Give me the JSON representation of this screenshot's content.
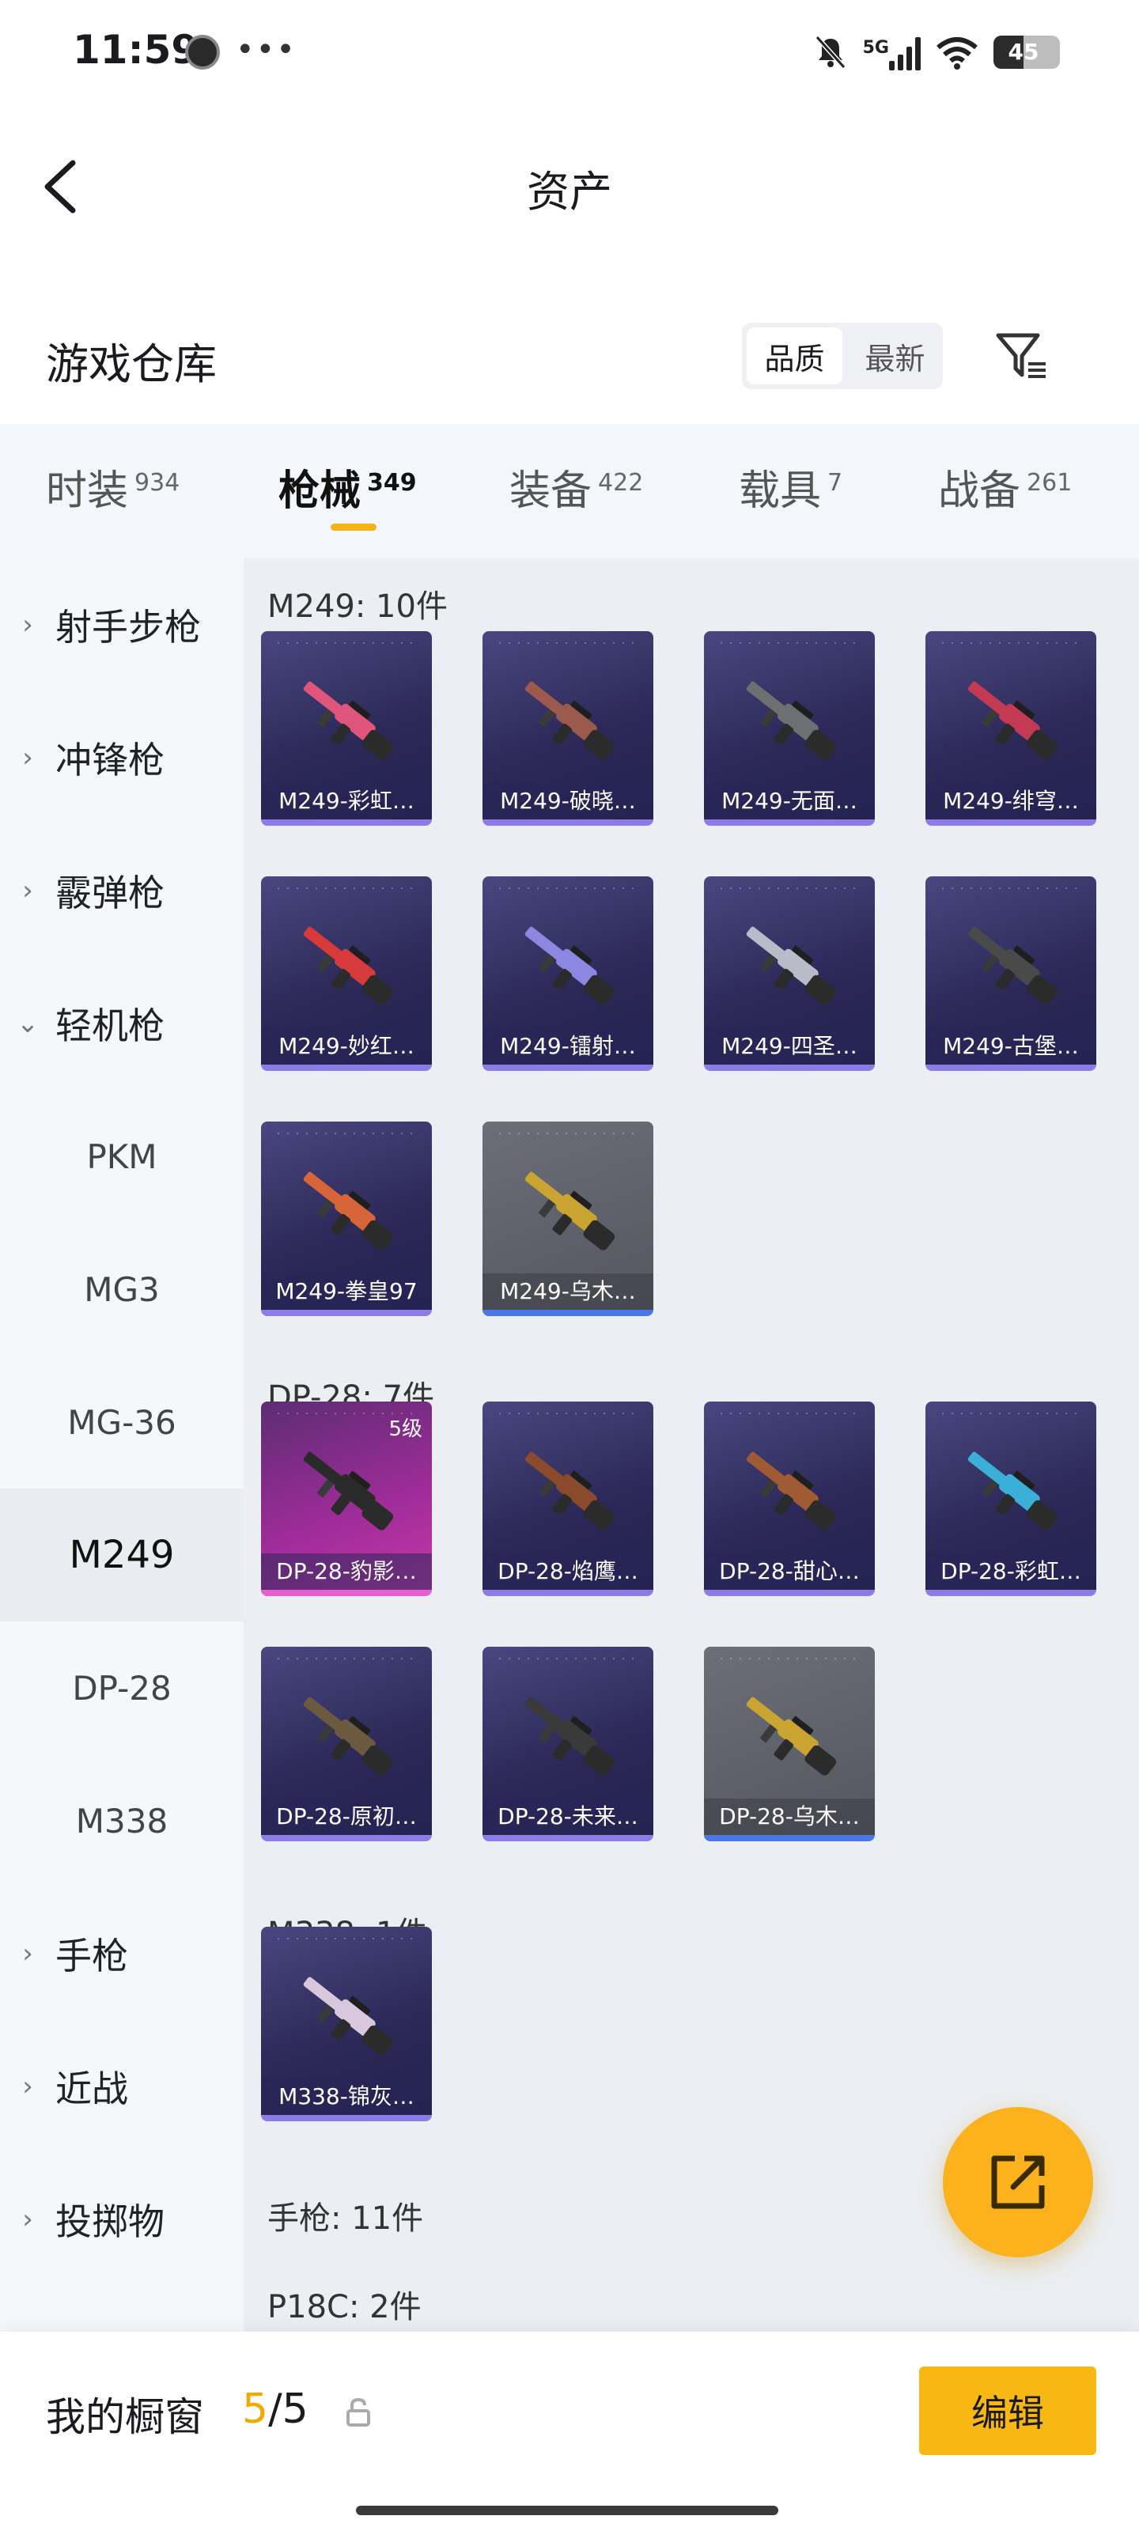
{
  "status_bar": {
    "time": "11:59",
    "network": "5G",
    "battery": "45",
    "battery_level": 0.45,
    "icons": [
      "clock-icon",
      "more-icon",
      "mute-icon",
      "signal-icon",
      "wifi-icon",
      "battery-icon"
    ]
  },
  "header": {
    "title": "资产"
  },
  "warehouse": {
    "title": "游戏仓库",
    "sort_options": [
      "品质",
      "最新"
    ],
    "selected_sort": "品质"
  },
  "tabs": [
    {
      "label": "时装",
      "count": "934"
    },
    {
      "label": "枪械",
      "count": "349",
      "active": true
    },
    {
      "label": "装备",
      "count": "422"
    },
    {
      "label": "载具",
      "count": "7"
    },
    {
      "label": "战备",
      "count": "261"
    }
  ],
  "sidebar": {
    "categories": [
      {
        "label": "射手步枪",
        "expanded": false
      },
      {
        "label": "冲锋枪",
        "expanded": false
      },
      {
        "label": "霰弹枪",
        "expanded": false
      },
      {
        "label": "轻机枪",
        "expanded": true
      },
      {
        "label": "手枪",
        "expanded": false
      },
      {
        "label": "近战",
        "expanded": false
      },
      {
        "label": "投掷物",
        "expanded": false
      }
    ],
    "subitems": [
      "PKM",
      "MG3",
      "MG-36",
      "M249",
      "DP-28",
      "M338"
    ],
    "selected_subitem": "M249"
  },
  "groups": [
    {
      "label": "M249: 10件",
      "items": [
        {
          "name": "M249-彩虹…",
          "rarity": "purple",
          "gun_color": "#e0557b"
        },
        {
          "name": "M249-破晓…",
          "rarity": "purple",
          "gun_color": "#9b5a4b"
        },
        {
          "name": "M249-无面…",
          "rarity": "purple",
          "gun_color": "#6c7070"
        },
        {
          "name": "M249-绯穹…",
          "rarity": "purple",
          "gun_color": "#c43a55"
        },
        {
          "name": "M249-妙红…",
          "rarity": "purple",
          "gun_color": "#d63a3a"
        },
        {
          "name": "M249-镭射…",
          "rarity": "purple",
          "gun_color": "#8c87e0"
        },
        {
          "name": "M249-四圣…",
          "rarity": "purple",
          "gun_color": "#b8bcc8"
        },
        {
          "name": "M249-古堡…",
          "rarity": "purple",
          "gun_color": "#4a4a4a"
        },
        {
          "name": "M249-拳皇97",
          "rarity": "purple",
          "gun_color": "#d8643a"
        },
        {
          "name": "M249-乌木…",
          "rarity": "grey",
          "gun_color": "#c9a431"
        }
      ]
    },
    {
      "label": "DP-28: 7件",
      "items": [
        {
          "name": "DP-28-豹影…",
          "rarity": "pink",
          "level": "5级",
          "gun_color": "#2a2a2a"
        },
        {
          "name": "DP-28-焰鹰…",
          "rarity": "purple",
          "gun_color": "#8a4a2c"
        },
        {
          "name": "DP-28-甜心…",
          "rarity": "purple",
          "gun_color": "#a05a34"
        },
        {
          "name": "DP-28-彩虹…",
          "rarity": "purple",
          "gun_color": "#3ab0d8"
        },
        {
          "name": "DP-28-原初…",
          "rarity": "purple",
          "gun_color": "#6b5a40"
        },
        {
          "name": "DP-28-未来…",
          "rarity": "purple",
          "gun_color": "#3a3a3a"
        },
        {
          "name": "DP-28-乌木…",
          "rarity": "grey",
          "gun_color": "#c9a431"
        }
      ]
    },
    {
      "label": "M338: 1件",
      "items": [
        {
          "name": "M338-锦灰…",
          "rarity": "purple",
          "gun_color": "#d8c8de"
        }
      ]
    },
    {
      "label": "手枪: 11件",
      "items": []
    },
    {
      "label": "P18C: 2件",
      "items": []
    }
  ],
  "fab": {
    "icon": "share-external-icon"
  },
  "bottom_bar": {
    "label": "我的橱窗",
    "count_current": "5",
    "count_total": "/5",
    "edit_label": "编辑",
    "accent": "#f8b814"
  }
}
